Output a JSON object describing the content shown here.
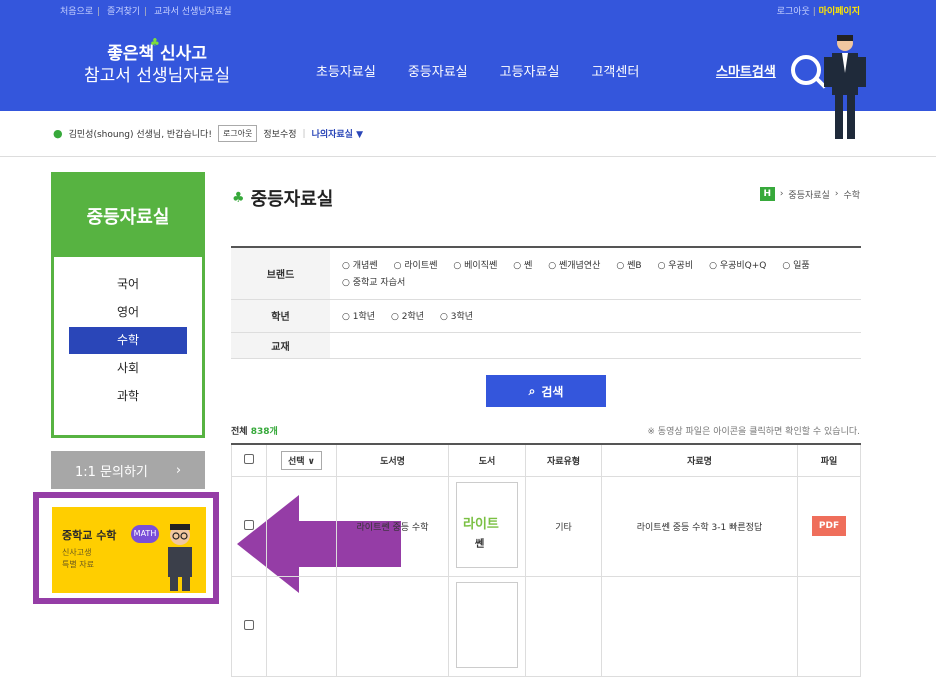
{
  "utility": {
    "left_links": [
      "처음으로",
      "즐겨찾기",
      "교과서 선생님자료실"
    ],
    "logout": "로그아웃",
    "mypage": "마이페이지"
  },
  "logo": {
    "line1": "좋은책 신사고",
    "line2": "참고서 선생님자료실"
  },
  "gnb": [
    "초등자료실",
    "중등자료실",
    "고등자료실",
    "고객센터"
  ],
  "smart_search": "스마트검색",
  "userbar": {
    "greeting": "김민성(shoung) 선생님, 반갑습니다!",
    "logout_button": "로그아웃",
    "edit_info": "정보수정",
    "my_room": "나의자료실 ▼"
  },
  "sidebar": {
    "title": "중등자료실",
    "items": [
      {
        "label": "국어",
        "active": false
      },
      {
        "label": "영어",
        "active": false
      },
      {
        "label": "수학",
        "active": true
      },
      {
        "label": "사회",
        "active": false
      },
      {
        "label": "과학",
        "active": false
      }
    ],
    "inquiry_label": "1:1 문의하기",
    "inquiry_chevron": "›"
  },
  "banner": {
    "title": "중학교 수학",
    "badge": "MATH",
    "sub1": "신사고생",
    "sub2": "특별 자료"
  },
  "main": {
    "title": "중등자료실",
    "breadcrumb": [
      "H",
      "중등자료실",
      "수학"
    ],
    "filter": {
      "brand_label": "브랜드",
      "brands": [
        "개념쎈",
        "라이트쎈",
        "베이직쎈",
        "쎈",
        "쎈개념연산",
        "쎈B",
        "우공비",
        "우공비Q+Q",
        "일품",
        "중학교 자습서"
      ],
      "grade_label": "학년",
      "grades": [
        "1학년",
        "2학년",
        "3학년"
      ],
      "textbook_label": "교재"
    },
    "search_button": "검색",
    "total_label": "전체",
    "total_count": "838개",
    "note": "※ 동영상 파일은 아이콘을 클릭하면 확인할 수 있습니다.",
    "table": {
      "headers": [
        "",
        "선택",
        "도서명",
        "도서",
        "자료유형",
        "자료명",
        "파일"
      ],
      "select_label": "선택 ∨",
      "rows": [
        {
          "book_name": "라이트쎈 중등 수학",
          "cover_title": "라이트",
          "cover_sub": "쎈",
          "type": "기타",
          "name": "라이트쎈 중등 수학 3-1 빠른정답",
          "file": "PDF"
        }
      ]
    }
  },
  "colors": {
    "brand_blue": "#3456dc",
    "green": "#57b341",
    "purple_annotation": "#953da6",
    "pdf_red": "#ef6e5b",
    "banner_yellow": "#ffce00"
  }
}
